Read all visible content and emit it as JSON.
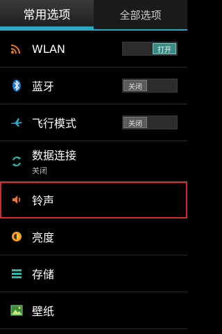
{
  "tabs": {
    "common": "常用选项",
    "all": "全部选项"
  },
  "items": [
    {
      "label": "WLAN",
      "icon": "wifi-icon",
      "toggle": "打开"
    },
    {
      "label": "蓝牙",
      "icon": "bluetooth-icon",
      "toggle": "关闭"
    },
    {
      "label": "飞行模式",
      "icon": "airplane-icon",
      "toggle": "关闭"
    },
    {
      "label": "数据连接",
      "sub": "关闭",
      "icon": "data-sync-icon"
    },
    {
      "label": "铃声",
      "icon": "speaker-icon"
    },
    {
      "label": "亮度",
      "icon": "brightness-icon"
    },
    {
      "label": "存储",
      "icon": "storage-icon"
    },
    {
      "label": "壁纸",
      "icon": "wallpaper-icon"
    }
  ],
  "colors": {
    "accent": "#2ba7c5",
    "highlight": "#d32a2a"
  }
}
